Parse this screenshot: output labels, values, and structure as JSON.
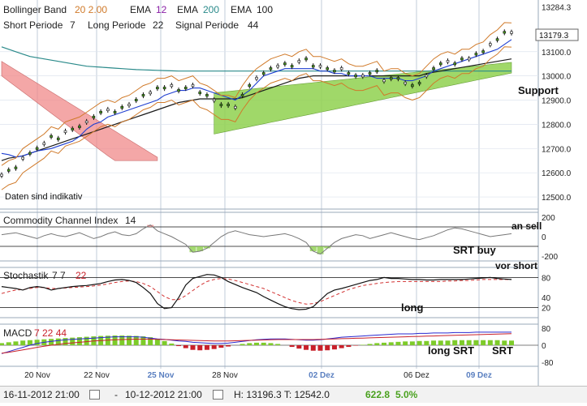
{
  "colors": {
    "bollinger": "#d07a2a",
    "ema12": "#1f3fd1",
    "ema200": "#2a8a8a",
    "ema100": "#1a1a1a",
    "ichimoku_bear": "#f08a8a",
    "ichimoku_bull": "#8fd14f",
    "purple": "#8a1fa6",
    "grid": "#a8b6c8",
    "panel_line": "#303030",
    "macd_pos": "#7ecb2a",
    "macd_neg": "#c8202a",
    "macd_line": "#2a2ad0",
    "signal_line": "#c8202a",
    "price_green": "#4aa11f",
    "pct_green": "#4aa11f",
    "date_blue": "#5a7fc0"
  },
  "legend": {
    "row1": [
      {
        "name": "Bollinger Band",
        "params": "20  2.00",
        "params_color": "#d07a2a"
      },
      {
        "name": "EMA",
        "params": "12",
        "params_color": "#8a1fa6"
      },
      {
        "name": "EMA",
        "params": "200",
        "params_color": "#2a8a8a"
      },
      {
        "name": "EMA",
        "params": "100",
        "params_color": "#1a1a1a"
      }
    ],
    "row2": [
      {
        "name": "Short Periode",
        "params": "7"
      },
      {
        "name": "Long Periode",
        "params": "22"
      },
      {
        "name": "Signal Periode",
        "params": "44"
      }
    ]
  },
  "disclaimer": "Daten sind indikativ",
  "annotations": {
    "support": "Support",
    "an_sell": "an sell",
    "srt_buy": "SRT buy",
    "vor_short": "vor short",
    "long": "long",
    "long_srt": "long SRT",
    "srt": "SRT"
  },
  "panels": {
    "cci": {
      "label": "Commodity Channel Index",
      "params": "14",
      "ticks": [
        "200",
        "0",
        "-200"
      ]
    },
    "stoch": {
      "label": "Stochastik",
      "params": "7  7",
      "param_red": "22",
      "ticks": [
        "80",
        "40",
        "20"
      ]
    },
    "macd": {
      "label": "MACD",
      "params": "7  22  44",
      "ticks": [
        "80",
        "0",
        "-80"
      ]
    }
  },
  "x_ticks": [
    {
      "label": "20 Nov",
      "highlight": false
    },
    {
      "label": "22 Nov",
      "highlight": false
    },
    {
      "label": "25 Nov",
      "highlight": true
    },
    {
      "label": "28 Nov",
      "highlight": false
    },
    {
      "label": "02 Dez",
      "highlight": true
    },
    {
      "label": "06 Dez",
      "highlight": false
    },
    {
      "label": "09 Dez",
      "highlight": true
    }
  ],
  "status": {
    "from": "16-11-2012 21:00",
    "sep": "-",
    "to": "10-12-2012 21:00",
    "hl": "H: 13196.3  T: 12542.0",
    "change": "622.8",
    "pct": "5.0%"
  },
  "chart_data": {
    "type": "line",
    "ylim": [
      12450,
      13300
    ],
    "y_ticks": [
      13284.3,
      13100,
      13000,
      12900,
      12800,
      12700,
      12600,
      12500
    ],
    "y_tick_labels": [
      "13284.3",
      "13100.0",
      "13000.0",
      "12900.0",
      "12800.0",
      "12700.0",
      "12600.0",
      "12500.0"
    ],
    "last_price": 13179.3,
    "last_price_label": "13179.3",
    "price": [
      12590,
      12610,
      12620,
      12660,
      12680,
      12700,
      12720,
      12750,
      12740,
      12770,
      12780,
      12790,
      12810,
      12830,
      12850,
      12860,
      12850,
      12870,
      12880,
      12900,
      12920,
      12930,
      12950,
      12950,
      12960,
      12940,
      12950,
      12960,
      12930,
      12920,
      12900,
      12880,
      12880,
      12870,
      12920,
      12960,
      12990,
      13010,
      13030,
      13040,
      13050,
      13040,
      13060,
      13070,
      13040,
      13040,
      13030,
      13020,
      13030,
      13010,
      13000,
      13000,
      13010,
      13020,
      12980,
      12990,
      12990,
      12970,
      12960,
      12970,
      13000,
      13030,
      13050,
      13060,
      13050,
      13070,
      13070,
      13090,
      13100,
      13130,
      13150,
      13180,
      13179
    ],
    "ema12": [
      12680,
      12675,
      12665,
      12670,
      12680,
      12690,
      12695,
      12700,
      12710,
      12720,
      12730,
      12750,
      12780,
      12800,
      12810,
      12830,
      12840,
      12850,
      12860,
      12870,
      12880,
      12890,
      12900,
      12920,
      12930,
      12940,
      12940,
      12950,
      12950,
      12940,
      12930,
      12920,
      12910,
      12900,
      12920,
      12940,
      12970,
      13000,
      13010,
      13020,
      13030,
      13030,
      13030,
      13030,
      13030,
      13020,
      13020,
      13010,
      13010,
      13000,
      13000,
      13000,
      13000,
      12990,
      12990,
      12990,
      12990,
      12980,
      12980,
      12990,
      13000,
      13020,
      13030,
      13040,
      13050,
      13060,
      13070,
      13080,
      13090,
      13100,
      13110,
      13130,
      13150
    ],
    "ema100": [
      12650,
      12660,
      12665,
      12670,
      12680,
      12690,
      12700,
      12710,
      12720,
      12730,
      12740,
      12750,
      12760,
      12770,
      12780,
      12790,
      12800,
      12810,
      12820,
      12830,
      12840,
      12850,
      12860,
      12870,
      12880,
      12890,
      12895,
      12900,
      12905,
      12905,
      12905,
      12905,
      12905,
      12905,
      12910,
      12920,
      12930,
      12940,
      12950,
      12960,
      12970,
      12980,
      12990,
      12995,
      13000,
      13000,
      13000,
      13000,
      13000,
      13000,
      13000,
      13000,
      13000,
      13000,
      13000,
      13000,
      13000,
      13000,
      13000,
      13000,
      13010,
      13015,
      13020,
      13025,
      13030,
      13035,
      13040,
      13045,
      13050,
      13055,
      13060,
      13065,
      13070
    ],
    "ema200": [
      13120,
      13110,
      13100,
      13090,
      13080,
      13075,
      13070,
      13065,
      13060,
      13055,
      13050,
      13045,
      13040,
      13038,
      13036,
      13034,
      13032,
      13030,
      13028,
      13026,
      13025,
      13024,
      13023,
      13022,
      13021,
      13020,
      13020,
      13020,
      13020,
      13020,
      13020,
      13020,
      13020,
      13020,
      13020,
      13020,
      13020,
      13020,
      13020,
      13020,
      13020,
      13020,
      13020,
      13020,
      13020,
      13020,
      13020,
      13020,
      13020,
      13020,
      13020,
      13020,
      13020,
      13020,
      13020,
      13020,
      13020,
      13020,
      13020,
      13020,
      13020,
      13020,
      13020,
      13020,
      13020,
      13020,
      13020,
      13020,
      13020,
      13020,
      13020,
      13020,
      13020
    ],
    "cci": [
      20,
      30,
      40,
      20,
      0,
      -20,
      10,
      30,
      10,
      0,
      20,
      40,
      10,
      -20,
      0,
      30,
      50,
      20,
      10,
      30,
      80,
      120,
      60,
      30,
      0,
      -40,
      -80,
      -160,
      -150,
      -120,
      -60,
      0,
      40,
      60,
      40,
      20,
      10,
      0,
      10,
      20,
      30,
      10,
      -20,
      -60,
      -150,
      -180,
      -120,
      -60,
      -20,
      0,
      20,
      10,
      -20,
      0,
      20,
      40,
      20,
      0,
      -20,
      -30,
      -10,
      10,
      40,
      70,
      90,
      80,
      60,
      40,
      20,
      0,
      10,
      20,
      30
    ],
    "stoch": [
      62,
      60,
      58,
      55,
      60,
      62,
      60,
      55,
      58,
      60,
      62,
      63,
      64,
      66,
      68,
      72,
      75,
      76,
      74,
      70,
      60,
      48,
      28,
      18,
      20,
      40,
      65,
      78,
      82,
      86,
      85,
      80,
      72,
      66,
      60,
      55,
      50,
      42,
      35,
      28,
      22,
      18,
      16,
      17,
      22,
      35,
      48,
      55,
      58,
      62,
      66,
      70,
      74,
      76,
      80,
      78,
      78,
      77,
      76,
      76,
      75,
      75,
      76,
      76,
      76,
      76,
      77,
      78,
      79,
      80,
      78,
      77,
      76
    ],
    "stoch_signal": [
      48,
      52,
      55,
      56,
      58,
      60,
      60,
      58,
      58,
      59,
      60,
      61,
      62,
      63,
      65,
      67,
      70,
      72,
      73,
      72,
      68,
      62,
      52,
      42,
      36,
      36,
      44,
      54,
      64,
      72,
      76,
      78,
      77,
      74,
      70,
      66,
      62,
      58,
      52,
      46,
      40,
      34,
      30,
      27,
      28,
      32,
      38,
      44,
      50,
      56,
      60,
      64,
      66,
      68,
      70,
      71,
      72,
      72,
      72,
      72,
      72,
      72,
      72,
      73,
      73,
      74,
      74,
      75,
      76,
      76,
      76,
      76,
      76
    ],
    "macd": [
      10,
      14,
      18,
      22,
      24,
      26,
      28,
      30,
      32,
      34,
      36,
      38,
      40,
      42,
      44,
      45,
      46,
      46,
      45,
      44,
      42,
      38,
      30,
      20,
      8,
      -4,
      -14,
      -22,
      -24,
      -22,
      -18,
      -12,
      -6,
      0,
      6,
      10,
      12,
      12,
      10,
      6,
      0,
      -8,
      -16,
      -22,
      -26,
      -26,
      -24,
      -20,
      -14,
      -8,
      -2,
      2,
      6,
      10,
      12,
      14,
      16,
      18,
      18,
      20,
      20,
      22,
      22,
      22,
      24,
      24,
      24,
      24,
      24,
      24,
      24,
      22,
      22
    ],
    "macd_line": [
      -40,
      -30,
      -20,
      -10,
      0,
      8,
      14,
      18,
      22,
      26,
      28,
      30,
      32,
      34,
      36,
      38,
      40,
      40,
      40,
      40,
      38,
      34,
      30,
      28,
      24,
      20,
      18,
      14,
      12,
      10,
      8,
      8,
      10,
      14,
      18,
      22,
      26,
      28,
      30,
      30,
      30,
      28,
      26,
      24,
      24,
      26,
      30,
      34,
      38,
      40,
      42,
      44,
      46,
      48,
      50,
      52,
      54,
      54,
      54,
      56,
      56,
      58,
      58,
      58,
      60,
      60,
      60,
      62,
      62,
      62,
      62,
      62,
      62
    ],
    "macd_signal": [
      -38,
      -34,
      -28,
      -22,
      -16,
      -10,
      -5,
      0,
      4,
      8,
      11,
      14,
      17,
      20,
      22,
      24,
      26,
      27,
      28,
      29,
      29,
      29,
      28,
      27,
      26,
      25,
      24,
      23,
      22,
      21,
      20,
      20,
      20,
      21,
      22,
      23,
      24,
      25,
      26,
      27,
      27,
      27,
      27,
      27,
      27,
      28,
      29,
      30,
      31,
      32,
      33,
      34,
      35,
      36,
      37,
      38,
      39,
      40,
      41,
      42,
      43,
      44,
      45,
      46,
      47,
      48,
      49,
      50,
      51,
      52,
      53,
      54,
      55
    ]
  }
}
